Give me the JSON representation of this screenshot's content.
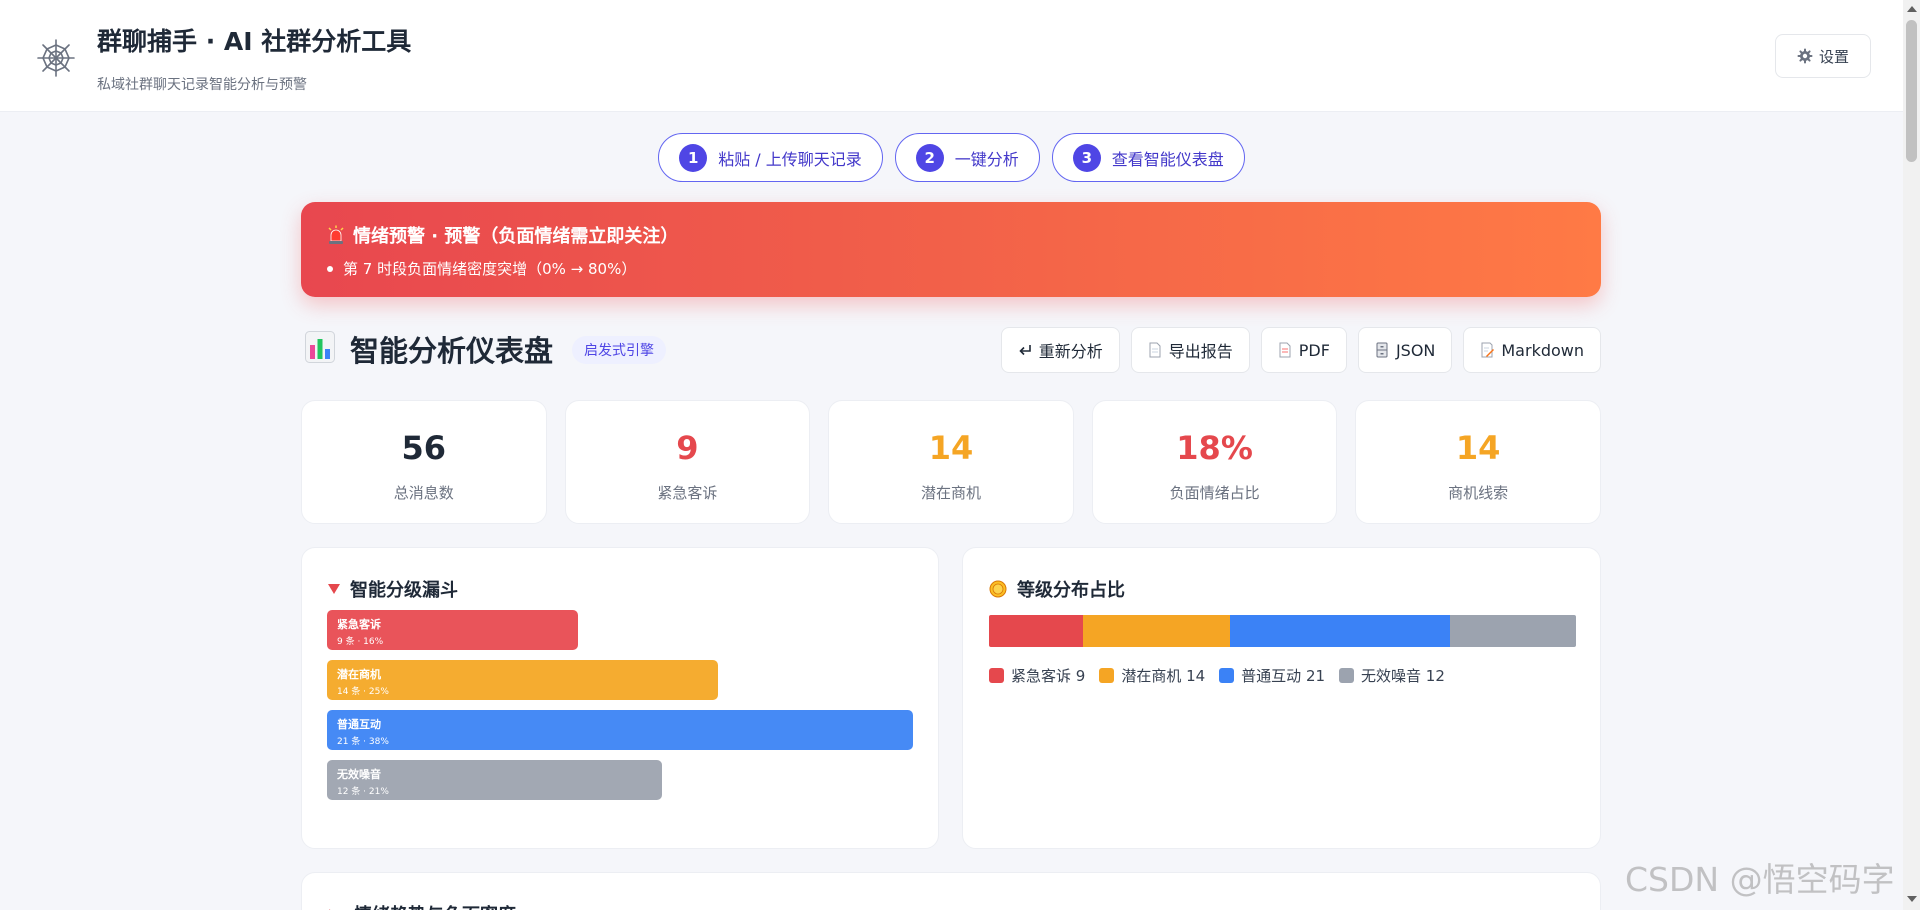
{
  "header": {
    "title": "群聊捕手 · AI 社群分析工具",
    "subtitle": "私域社群聊天记录智能分析与预警",
    "settings_label": "设置"
  },
  "steps": [
    {
      "num": "1",
      "label": "粘贴 / 上传聊天记录"
    },
    {
      "num": "2",
      "label": "一键分析"
    },
    {
      "num": "3",
      "label": "查看智能仪表盘"
    }
  ],
  "alert": {
    "title": "情绪预警 · 预警（负面情绪需立即关注）",
    "items": [
      "第 7 时段负面情绪密度突增（0% → 80%）"
    ]
  },
  "dashboard": {
    "title": "智能分析仪表盘",
    "tag": "启发式引擎",
    "toolbar": {
      "reanalyze": "重新分析",
      "export": "导出报告",
      "pdf": "PDF",
      "json": "JSON",
      "markdown": "Markdown"
    }
  },
  "stats": [
    {
      "value": "56",
      "label": "总消息数",
      "color": "#1f2937"
    },
    {
      "value": "9",
      "label": "紧急客诉",
      "color": "#e5484d"
    },
    {
      "value": "14",
      "label": "潜在商机",
      "color": "#f5a524"
    },
    {
      "value": "18%",
      "label": "负面情绪占比",
      "color": "#e5484d"
    },
    {
      "value": "14",
      "label": "商机线索",
      "color": "#f5a524"
    }
  ],
  "funnel": {
    "title": "智能分级漏斗",
    "levels": [
      {
        "name": "紧急客诉",
        "meta": "9 条 · 16%",
        "count": 9,
        "color": "#e9545a"
      },
      {
        "name": "潜在商机",
        "meta": "14 条 · 25%",
        "count": 14,
        "color": "#f5ac30"
      },
      {
        "name": "普通互动",
        "meta": "21 条 · 38%",
        "count": 21,
        "color": "#468af5"
      },
      {
        "name": "无效噪音",
        "meta": "12 条 · 21%",
        "count": 12,
        "color": "#a2a8b3"
      }
    ]
  },
  "distribution": {
    "title": "等级分布占比",
    "segments": [
      {
        "label": "紧急客诉 9",
        "count": 9,
        "color": "#e5484d"
      },
      {
        "label": "潜在商机 14",
        "count": 14,
        "color": "#f5a524"
      },
      {
        "label": "普通互动 21",
        "count": 21,
        "color": "#3b82f6"
      },
      {
        "label": "无效噪音 12",
        "count": 12,
        "color": "#9ca3af"
      }
    ]
  },
  "trend": {
    "title": "情绪趋势与负面密度"
  },
  "watermark": "CSDN @悟空码字"
}
